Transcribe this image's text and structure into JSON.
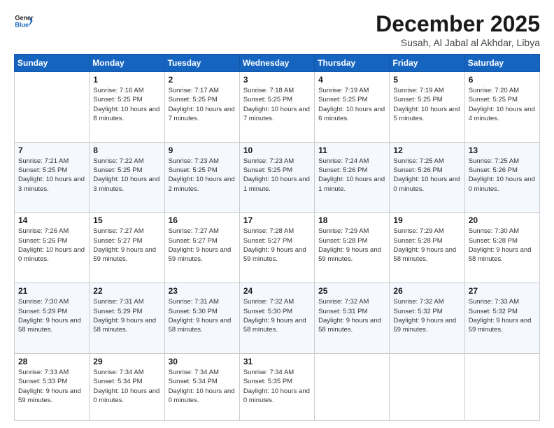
{
  "header": {
    "logo_general": "General",
    "logo_blue": "Blue",
    "month_title": "December 2025",
    "location": "Susah, Al Jabal al Akhdar, Libya"
  },
  "days_of_week": [
    "Sunday",
    "Monday",
    "Tuesday",
    "Wednesday",
    "Thursday",
    "Friday",
    "Saturday"
  ],
  "weeks": [
    [
      {
        "day": "",
        "sunrise": "",
        "sunset": "",
        "daylight": ""
      },
      {
        "day": "1",
        "sunrise": "Sunrise: 7:16 AM",
        "sunset": "Sunset: 5:25 PM",
        "daylight": "Daylight: 10 hours and 8 minutes."
      },
      {
        "day": "2",
        "sunrise": "Sunrise: 7:17 AM",
        "sunset": "Sunset: 5:25 PM",
        "daylight": "Daylight: 10 hours and 7 minutes."
      },
      {
        "day": "3",
        "sunrise": "Sunrise: 7:18 AM",
        "sunset": "Sunset: 5:25 PM",
        "daylight": "Daylight: 10 hours and 7 minutes."
      },
      {
        "day": "4",
        "sunrise": "Sunrise: 7:19 AM",
        "sunset": "Sunset: 5:25 PM",
        "daylight": "Daylight: 10 hours and 6 minutes."
      },
      {
        "day": "5",
        "sunrise": "Sunrise: 7:19 AM",
        "sunset": "Sunset: 5:25 PM",
        "daylight": "Daylight: 10 hours and 5 minutes."
      },
      {
        "day": "6",
        "sunrise": "Sunrise: 7:20 AM",
        "sunset": "Sunset: 5:25 PM",
        "daylight": "Daylight: 10 hours and 4 minutes."
      }
    ],
    [
      {
        "day": "7",
        "sunrise": "Sunrise: 7:21 AM",
        "sunset": "Sunset: 5:25 PM",
        "daylight": "Daylight: 10 hours and 3 minutes."
      },
      {
        "day": "8",
        "sunrise": "Sunrise: 7:22 AM",
        "sunset": "Sunset: 5:25 PM",
        "daylight": "Daylight: 10 hours and 3 minutes."
      },
      {
        "day": "9",
        "sunrise": "Sunrise: 7:23 AM",
        "sunset": "Sunset: 5:25 PM",
        "daylight": "Daylight: 10 hours and 2 minutes."
      },
      {
        "day": "10",
        "sunrise": "Sunrise: 7:23 AM",
        "sunset": "Sunset: 5:25 PM",
        "daylight": "Daylight: 10 hours and 1 minute."
      },
      {
        "day": "11",
        "sunrise": "Sunrise: 7:24 AM",
        "sunset": "Sunset: 5:26 PM",
        "daylight": "Daylight: 10 hours and 1 minute."
      },
      {
        "day": "12",
        "sunrise": "Sunrise: 7:25 AM",
        "sunset": "Sunset: 5:26 PM",
        "daylight": "Daylight: 10 hours and 0 minutes."
      },
      {
        "day": "13",
        "sunrise": "Sunrise: 7:25 AM",
        "sunset": "Sunset: 5:26 PM",
        "daylight": "Daylight: 10 hours and 0 minutes."
      }
    ],
    [
      {
        "day": "14",
        "sunrise": "Sunrise: 7:26 AM",
        "sunset": "Sunset: 5:26 PM",
        "daylight": "Daylight: 10 hours and 0 minutes."
      },
      {
        "day": "15",
        "sunrise": "Sunrise: 7:27 AM",
        "sunset": "Sunset: 5:27 PM",
        "daylight": "Daylight: 9 hours and 59 minutes."
      },
      {
        "day": "16",
        "sunrise": "Sunrise: 7:27 AM",
        "sunset": "Sunset: 5:27 PM",
        "daylight": "Daylight: 9 hours and 59 minutes."
      },
      {
        "day": "17",
        "sunrise": "Sunrise: 7:28 AM",
        "sunset": "Sunset: 5:27 PM",
        "daylight": "Daylight: 9 hours and 59 minutes."
      },
      {
        "day": "18",
        "sunrise": "Sunrise: 7:29 AM",
        "sunset": "Sunset: 5:28 PM",
        "daylight": "Daylight: 9 hours and 59 minutes."
      },
      {
        "day": "19",
        "sunrise": "Sunrise: 7:29 AM",
        "sunset": "Sunset: 5:28 PM",
        "daylight": "Daylight: 9 hours and 58 minutes."
      },
      {
        "day": "20",
        "sunrise": "Sunrise: 7:30 AM",
        "sunset": "Sunset: 5:28 PM",
        "daylight": "Daylight: 9 hours and 58 minutes."
      }
    ],
    [
      {
        "day": "21",
        "sunrise": "Sunrise: 7:30 AM",
        "sunset": "Sunset: 5:29 PM",
        "daylight": "Daylight: 9 hours and 58 minutes."
      },
      {
        "day": "22",
        "sunrise": "Sunrise: 7:31 AM",
        "sunset": "Sunset: 5:29 PM",
        "daylight": "Daylight: 9 hours and 58 minutes."
      },
      {
        "day": "23",
        "sunrise": "Sunrise: 7:31 AM",
        "sunset": "Sunset: 5:30 PM",
        "daylight": "Daylight: 9 hours and 58 minutes."
      },
      {
        "day": "24",
        "sunrise": "Sunrise: 7:32 AM",
        "sunset": "Sunset: 5:30 PM",
        "daylight": "Daylight: 9 hours and 58 minutes."
      },
      {
        "day": "25",
        "sunrise": "Sunrise: 7:32 AM",
        "sunset": "Sunset: 5:31 PM",
        "daylight": "Daylight: 9 hours and 58 minutes."
      },
      {
        "day": "26",
        "sunrise": "Sunrise: 7:32 AM",
        "sunset": "Sunset: 5:32 PM",
        "daylight": "Daylight: 9 hours and 59 minutes."
      },
      {
        "day": "27",
        "sunrise": "Sunrise: 7:33 AM",
        "sunset": "Sunset: 5:32 PM",
        "daylight": "Daylight: 9 hours and 59 minutes."
      }
    ],
    [
      {
        "day": "28",
        "sunrise": "Sunrise: 7:33 AM",
        "sunset": "Sunset: 5:33 PM",
        "daylight": "Daylight: 9 hours and 59 minutes."
      },
      {
        "day": "29",
        "sunrise": "Sunrise: 7:34 AM",
        "sunset": "Sunset: 5:34 PM",
        "daylight": "Daylight: 10 hours and 0 minutes."
      },
      {
        "day": "30",
        "sunrise": "Sunrise: 7:34 AM",
        "sunset": "Sunset: 5:34 PM",
        "daylight": "Daylight: 10 hours and 0 minutes."
      },
      {
        "day": "31",
        "sunrise": "Sunrise: 7:34 AM",
        "sunset": "Sunset: 5:35 PM",
        "daylight": "Daylight: 10 hours and 0 minutes."
      },
      {
        "day": "",
        "sunrise": "",
        "sunset": "",
        "daylight": ""
      },
      {
        "day": "",
        "sunrise": "",
        "sunset": "",
        "daylight": ""
      },
      {
        "day": "",
        "sunrise": "",
        "sunset": "",
        "daylight": ""
      }
    ]
  ]
}
